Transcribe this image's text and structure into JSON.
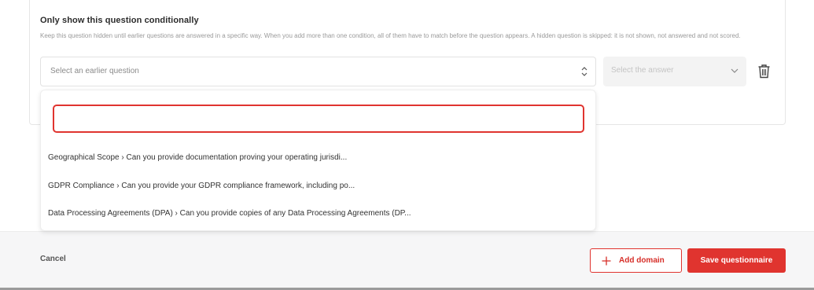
{
  "condition": {
    "title": "Only show this question conditionally",
    "description": "Keep this question hidden until earlier questions are answered in a specific way. When you add more than one condition, all of them have to match before the question appears. A hidden question is skipped: it is not shown, not answered and not scored.",
    "question_select_placeholder": "Select an earlier question",
    "answer_select_placeholder": "Select the answer"
  },
  "dropdown": {
    "search_value": "",
    "options": [
      "Geographical Scope › Can you provide documentation proving your operating jurisdi...",
      "GDPR Compliance › Can you provide your GDPR compliance framework, including po...",
      "Data Processing Agreements (DPA) › Can you provide copies of any Data Processing Agreements (DP..."
    ]
  },
  "footer": {
    "cancel_label": "Cancel",
    "add_domain_label": "Add domain",
    "save_label": "Save questionnaire"
  },
  "colors": {
    "accent": "#e0342f",
    "footer_bg": "#f6f6f7"
  },
  "icons": {
    "question_select": "updown-chevron-icon",
    "answer_select": "chevron-down-icon",
    "delete": "trash-icon",
    "add": "plus-icon"
  }
}
